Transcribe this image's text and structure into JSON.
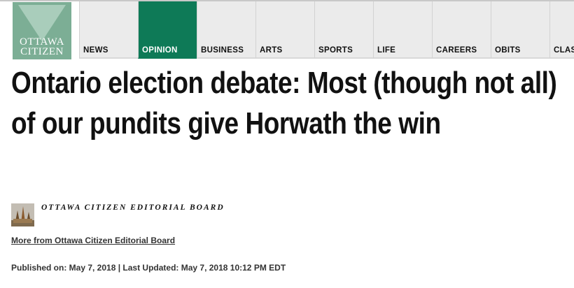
{
  "header": {
    "logo": {
      "line1": "OTTAWA",
      "line2": "CITIZEN"
    },
    "nav": [
      {
        "label": "NEWS",
        "active": false
      },
      {
        "label": "OPINION",
        "active": true
      },
      {
        "label": "BUSINESS",
        "active": false
      },
      {
        "label": "ARTS",
        "active": false
      },
      {
        "label": "SPORTS",
        "active": false
      },
      {
        "label": "LIFE",
        "active": false
      },
      {
        "label": "CAREERS",
        "active": false
      },
      {
        "label": "OBITS",
        "active": false
      },
      {
        "label": "CLAS",
        "active": false
      }
    ]
  },
  "article": {
    "headline": "Ontario election debate: Most (though not all) of our pundits give Horwath the win",
    "author": "OTTAWA CITIZEN EDITORIAL BOARD",
    "more_from": "More from Ottawa Citizen Editorial Board",
    "published": "Published on: May 7, 2018 | Last Updated: May 7, 2018 10:12 PM EDT"
  },
  "colors": {
    "brand_green": "#0e7a57",
    "logo_green": "#7cae95",
    "nav_bg": "#ebebeb"
  }
}
